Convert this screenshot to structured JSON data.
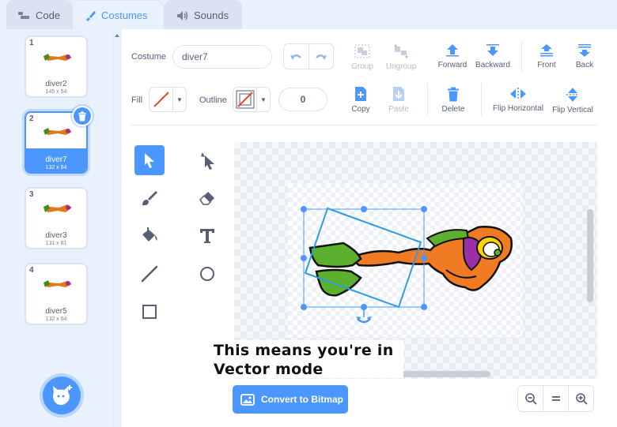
{
  "tabs": [
    {
      "label": "Code",
      "icon": "code-icon"
    },
    {
      "label": "Costumes",
      "icon": "costumes-brush-icon"
    },
    {
      "label": "Sounds",
      "icon": "speaker-icon"
    }
  ],
  "costumes": [
    {
      "number": "1",
      "name": "diver2",
      "size": "145 x 54"
    },
    {
      "number": "2",
      "name": "diver7",
      "size": "132 x 64"
    },
    {
      "number": "3",
      "name": "diver3",
      "size": "131 x 81"
    },
    {
      "number": "4",
      "name": "diver5",
      "size": "132 x 64"
    }
  ],
  "toolbar": {
    "costume_label": "Costume",
    "costume_name": "diver7",
    "group": "Group",
    "ungroup": "Ungroup",
    "forward": "Forward",
    "backward": "Backward",
    "front": "Front",
    "back": "Back",
    "fill_label": "Fill",
    "outline_label": "Outline",
    "outline_width": "0",
    "copy": "Copy",
    "paste": "Paste",
    "delete": "Delete",
    "flip_horizontal": "Flip Horizontal",
    "flip_vertical": "Flip Vertical"
  },
  "annotation": {
    "line1": "This means you're in",
    "line2": "Vector mode"
  },
  "convert_button": "Convert to Bitmap",
  "colors": {
    "accent": "#4c97ff",
    "fill_none_slash": "#e6492d",
    "text": "#575e75"
  }
}
